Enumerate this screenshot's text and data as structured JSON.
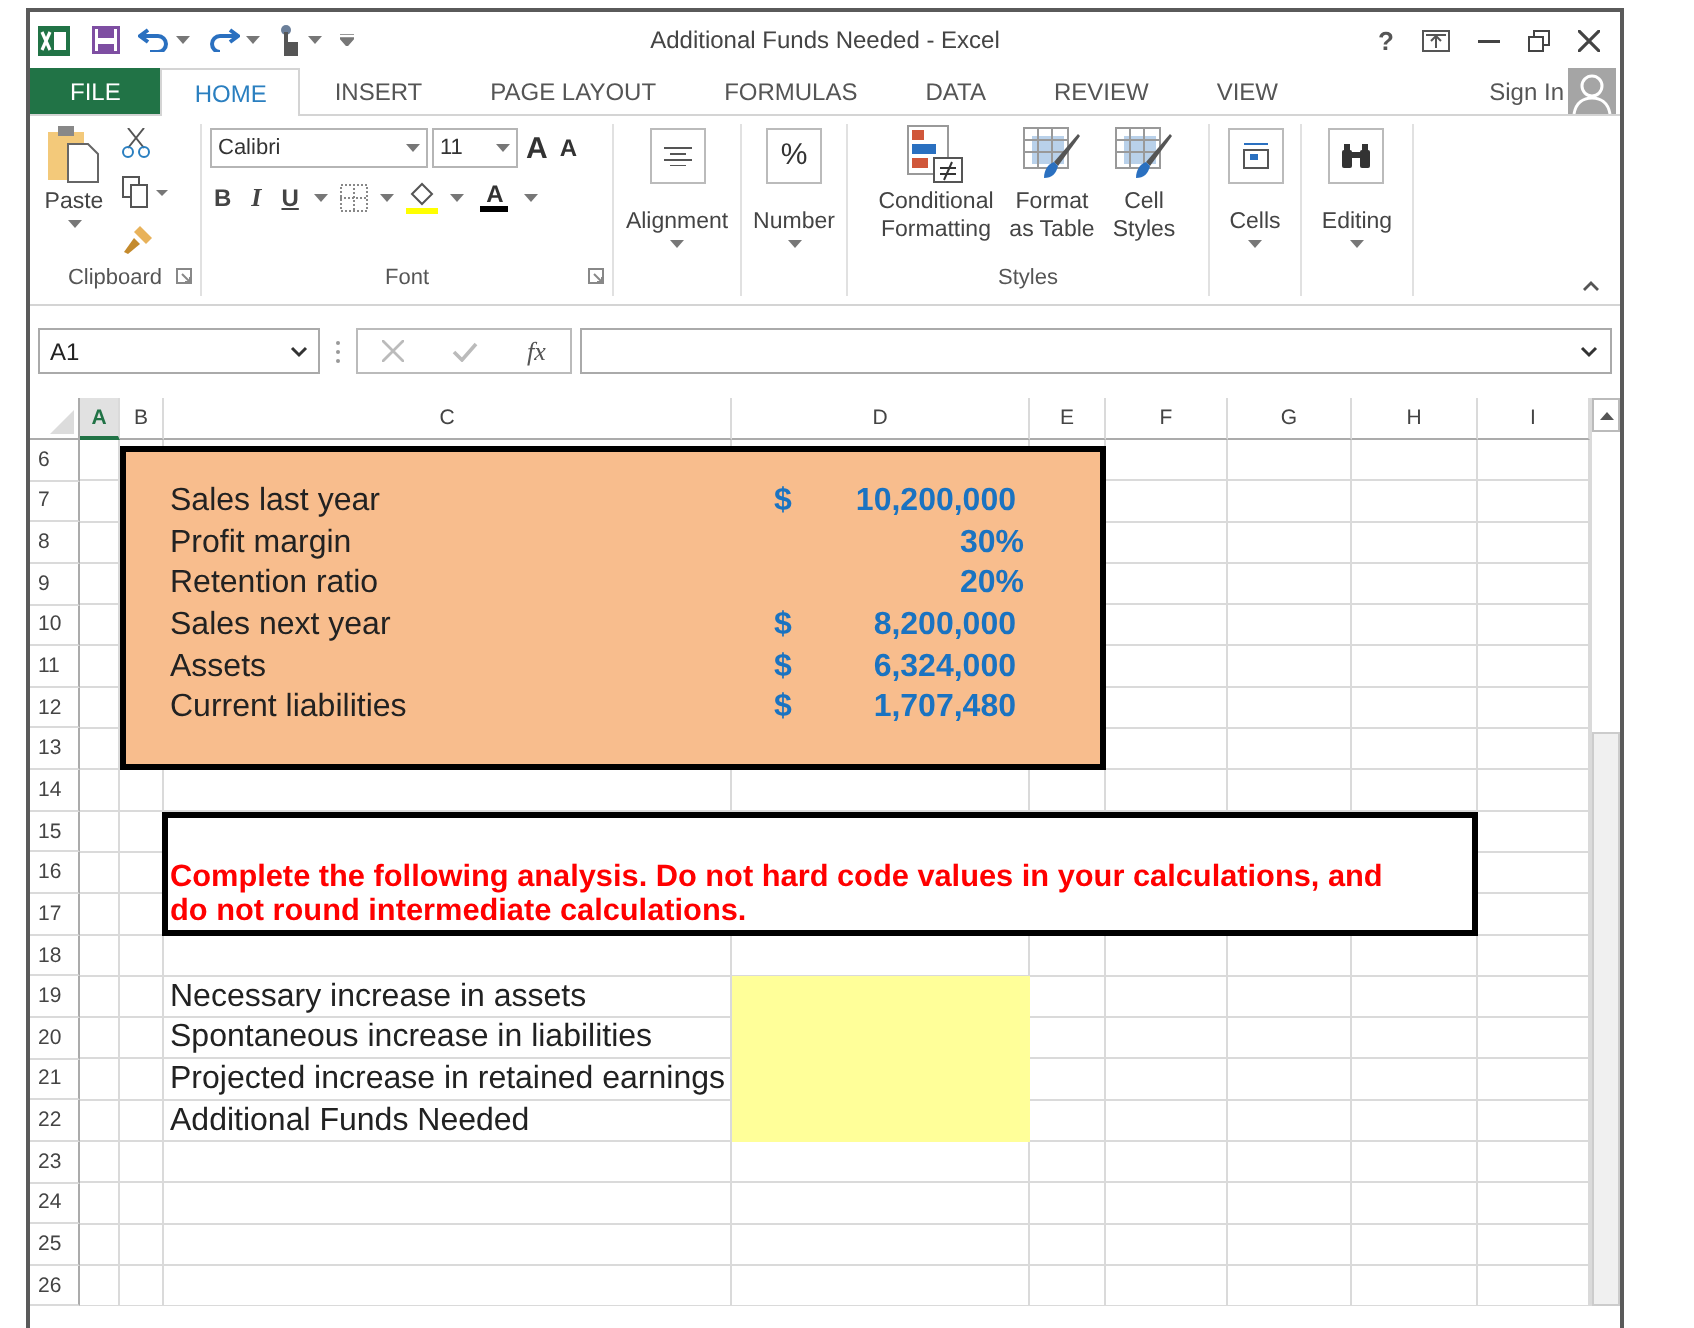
{
  "window": {
    "title": "Additional Funds Needed - Excel",
    "help": "?"
  },
  "tabs": [
    {
      "label": "FILE",
      "kind": "file",
      "selected": false
    },
    {
      "label": "HOME",
      "kind": "tab",
      "selected": true
    },
    {
      "label": "INSERT",
      "kind": "tab",
      "selected": false
    },
    {
      "label": "PAGE LAYOUT",
      "kind": "tab",
      "selected": false
    },
    {
      "label": "FORMULAS",
      "kind": "tab",
      "selected": false
    },
    {
      "label": "DATA",
      "kind": "tab",
      "selected": false
    },
    {
      "label": "REVIEW",
      "kind": "tab",
      "selected": false
    },
    {
      "label": "VIEW",
      "kind": "tab",
      "selected": false
    }
  ],
  "sign_in": "Sign In",
  "ribbon": [
    {
      "kind": "clipboard",
      "label": "Clipboard",
      "paste": "Paste"
    },
    {
      "kind": "font",
      "label": "Font",
      "font_name": "Calibri",
      "font_size": "11",
      "grow": "A",
      "shrink": "A",
      "bold": "B",
      "italic": "I",
      "underline": "U",
      "font_color": "A"
    },
    {
      "kind": "alignment",
      "label": "Alignment"
    },
    {
      "kind": "number",
      "label": "Number",
      "symbol": "%"
    },
    {
      "kind": "styles",
      "label": "Styles",
      "items": [
        "Conditional Formatting",
        "Format as Table",
        "Cell Styles"
      ]
    },
    {
      "kind": "cells",
      "label": "Cells"
    },
    {
      "kind": "editing",
      "label": "Editing"
    }
  ],
  "formula_bar": {
    "name_box": "A1",
    "function_label": "fx"
  },
  "columns": [
    {
      "label": "A",
      "selected": true
    },
    {
      "label": "B",
      "selected": false
    },
    {
      "label": "C",
      "selected": false
    },
    {
      "label": "D",
      "selected": false
    },
    {
      "label": "E",
      "selected": false
    },
    {
      "label": "F",
      "selected": false
    },
    {
      "label": "G",
      "selected": false
    },
    {
      "label": "H",
      "selected": false
    },
    {
      "label": "I",
      "selected": false
    }
  ],
  "rows": [
    "6",
    "7",
    "8",
    "9",
    "10",
    "11",
    "12",
    "13",
    "14",
    "15",
    "16",
    "17",
    "18",
    "19",
    "20",
    "21",
    "22",
    "23",
    "24",
    "25",
    "26"
  ],
  "inputs": [
    {
      "label": "Sales last year",
      "currency": "$",
      "value": "10,200,000"
    },
    {
      "label": "Profit margin",
      "value": "30%"
    },
    {
      "label": "Retention ratio",
      "value": "20%"
    },
    {
      "label": "Sales next year",
      "currency": "$",
      "value": "8,200,000"
    },
    {
      "label": "Assets",
      "currency": "$",
      "value": "6,324,000"
    },
    {
      "label": "Current liabilities",
      "currency": "$",
      "value": "1,707,480"
    }
  ],
  "instruction": "Complete the following analysis. Do not hard code values in your calculations, and do not round intermediate calculations.",
  "analysis": [
    {
      "label": "Necessary increase in assets"
    },
    {
      "label": "Spontaneous increase in liabilities"
    },
    {
      "label": "Projected increase in retained earnings"
    },
    {
      "label": "Additional Funds Needed"
    }
  ]
}
